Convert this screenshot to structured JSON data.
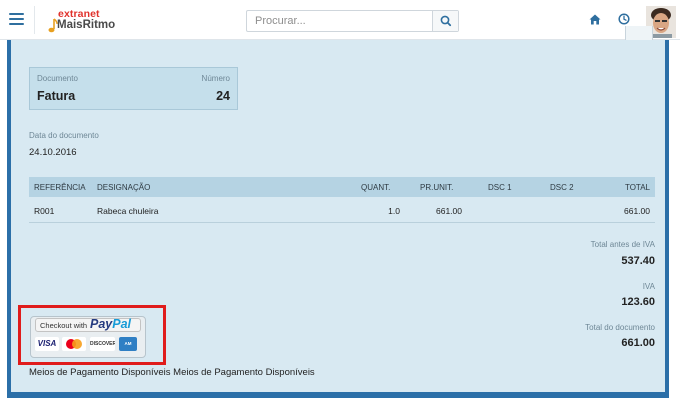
{
  "header": {
    "logo_line1": "extranet",
    "logo_line2": "MaisRitmo",
    "search_placeholder": "Procurar...",
    "icons": {
      "menu": "hamburger-icon",
      "search": "search-icon",
      "home": "home-icon",
      "clock": "clock-icon"
    }
  },
  "document": {
    "type_label": "Documento",
    "type_value": "Fatura",
    "number_label": "Número",
    "number_value": "24",
    "date_label": "Data do documento",
    "date_value": "24.10.2016"
  },
  "table": {
    "columns": [
      "REFERÊNCIA",
      "DESIGNAÇÃO",
      "QUANT.",
      "PR.UNIT.",
      "DSC 1",
      "DSC 2",
      "TOTAL"
    ],
    "rows": [
      {
        "ref": "R001",
        "designation": "Rabeca chuleira",
        "qty": "1.0",
        "unit_price": "661.00",
        "dsc1": "",
        "dsc2": "",
        "total": "661.00"
      }
    ]
  },
  "totals": {
    "before_vat_label": "Total antes de IVA",
    "before_vat_value": "537.40",
    "vat_label": "IVA",
    "vat_value": "123.60",
    "doc_total_label": "Total do documento",
    "doc_total_value": "661.00"
  },
  "paypal": {
    "checkout_text": "Checkout with",
    "brand_part1": "Pay",
    "brand_part2": "Pal",
    "cards": [
      "VISA",
      "MasterCard",
      "DISCOVER",
      "AMERICAN EXPRESS"
    ]
  },
  "payment_methods_text": "Meios de Pagamento Disponíveis Meios de Pagamento Disponíveis",
  "colors": {
    "accent": "#2b6fa8",
    "panel": "#d8e9f2",
    "table_header": "#b5d3e3",
    "highlight": "#e01c1c",
    "paypal_dark": "#253b80",
    "paypal_light": "#179bd7"
  }
}
